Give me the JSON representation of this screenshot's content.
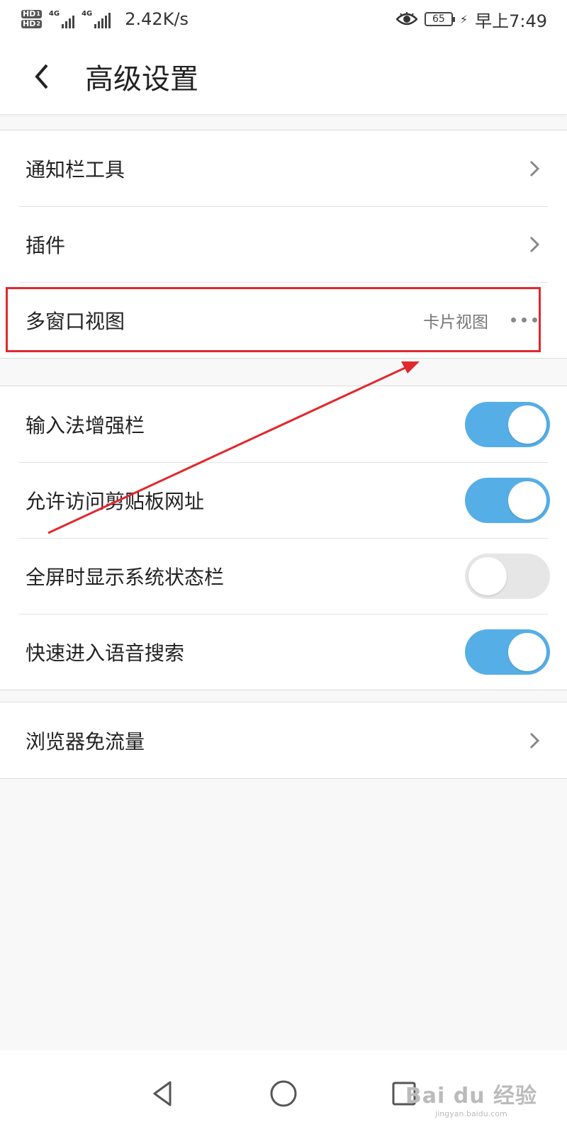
{
  "status_bar": {
    "sim1_badge": "HD",
    "sim1_index": "1",
    "sim2_badge": "HD",
    "sim2_index": "2",
    "network1": "4G",
    "network2": "4G",
    "net_speed": "2.42K/s",
    "battery": "65",
    "time": "早上7:49"
  },
  "header": {
    "title": "高级设置"
  },
  "group1": {
    "items": [
      {
        "label": "通知栏工具"
      },
      {
        "label": "插件"
      },
      {
        "label": "多窗口视图",
        "value": "卡片视图"
      }
    ]
  },
  "group2": {
    "items": [
      {
        "label": "输入法增强栏",
        "toggle": "on"
      },
      {
        "label": "允许访问剪贴板网址",
        "toggle": "on"
      },
      {
        "label": "全屏时显示系统状态栏",
        "toggle": "off"
      },
      {
        "label": "快速进入语音搜索",
        "toggle": "on"
      }
    ]
  },
  "group3": {
    "items": [
      {
        "label": "浏览器免流量"
      }
    ]
  },
  "colors": {
    "toggle_on": "#56aee6",
    "toggle_off": "#e6e6e6",
    "annotation": "#e0282d"
  },
  "watermark": {
    "main": "Bai du 经验",
    "sub": "jingyan.baidu.com"
  }
}
